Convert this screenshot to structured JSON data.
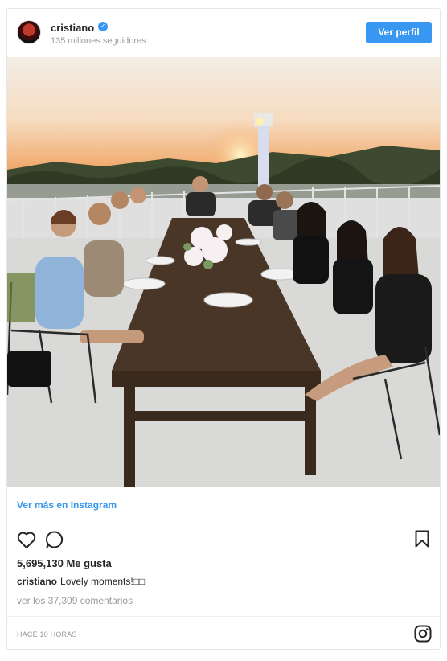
{
  "post": {
    "username": "cristiano",
    "verified_mark": "✓",
    "followers": "135 millones seguidores",
    "profile_button": "Ver perfil",
    "more_link": "Ver más en Instagram",
    "likes": "5,695,130 Me gusta",
    "caption_user": "cristiano",
    "caption_text": "Lovely moments!□□",
    "comments_link": "ver los 37,309 comentarios",
    "timestamp": "HACE 10 HORAS"
  },
  "icons": {
    "avatar": "avatar",
    "verified": "verified-badge-icon",
    "like": "heart-icon",
    "comment": "comment-bubble-icon",
    "save": "bookmark-icon",
    "brand": "instagram-logo-icon"
  },
  "colors": {
    "accent": "#3897f0",
    "text": "#262626",
    "muted": "#999999",
    "border": "#e6e6e6"
  }
}
